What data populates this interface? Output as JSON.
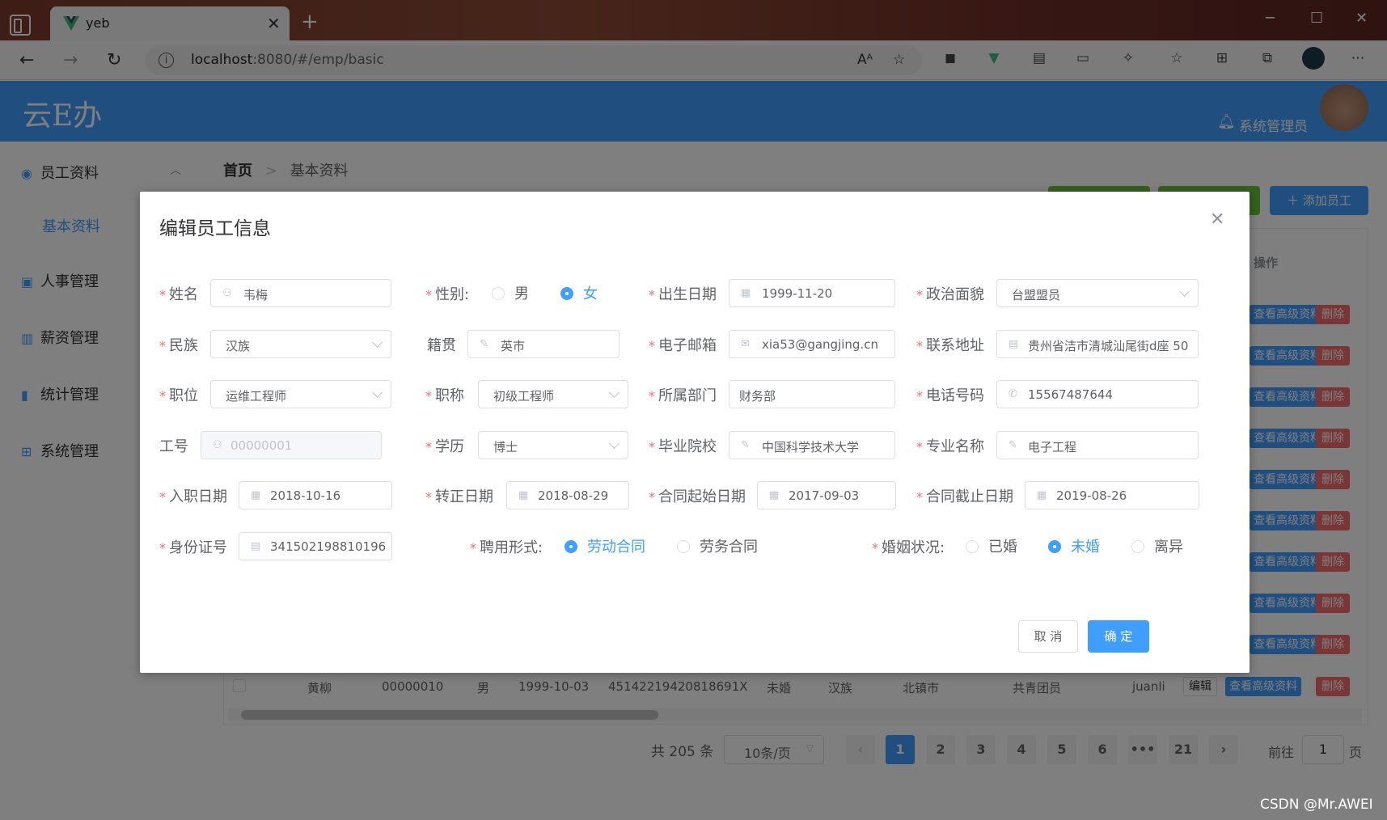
{
  "browser": {
    "tab_title": "yeb",
    "url_host": "localhost",
    "url_rest": ":8080/#/emp/basic"
  },
  "header": {
    "logo": "云E办",
    "user": "系统管理员"
  },
  "sidebar": {
    "items": [
      {
        "label": "员工资料"
      },
      {
        "label": "人事管理"
      },
      {
        "label": "薪资管理"
      },
      {
        "label": "统计管理"
      },
      {
        "label": "系统管理"
      }
    ],
    "active_sub": "基本资料"
  },
  "breadcrumb": {
    "home": "首页",
    "sep": ">",
    "current": "基本资料"
  },
  "toolbar": {
    "add_label": "添加员工"
  },
  "table": {
    "op_header": "操作",
    "adv_label": "查看高级资料",
    "del_label": "删除",
    "edit_label": "编辑",
    "last_row": {
      "name": "黄柳",
      "id": "00000010",
      "gender": "男",
      "birthday": "1999-10-03",
      "idcard": "45142219420818691X",
      "wedlock": "未婚",
      "nation": "汉族",
      "native": "北镇市",
      "politic": "共青团员",
      "email": "juanli"
    }
  },
  "pager": {
    "total": "共 205 条",
    "size": "10条/页",
    "pages": [
      "1",
      "2",
      "3",
      "4",
      "5",
      "6",
      "•••",
      "21"
    ],
    "goto_prefix": "前往",
    "goto_value": "1",
    "goto_suffix": "页"
  },
  "watermark": "CSDN @Mr.AWEI",
  "dialog": {
    "title": "编辑员工信息",
    "fields": {
      "name": {
        "label": "姓名",
        "value": "韦梅"
      },
      "gender": {
        "label": "性别:",
        "options": [
          "男",
          "女"
        ],
        "selected": "女"
      },
      "birthday": {
        "label": "出生日期",
        "value": "1999-11-20"
      },
      "politic": {
        "label": "政治面貌",
        "value": "台盟盟员"
      },
      "nation": {
        "label": "民族",
        "value": "汉族"
      },
      "native_place": {
        "label": "籍贯",
        "value": "英市"
      },
      "email": {
        "label": "电子邮箱",
        "value": "xia53@gangjing.cn"
      },
      "address": {
        "label": "联系地址",
        "value": "贵州省洁市清城汕尾街d座 50"
      },
      "job_level": {
        "label": "职位",
        "value": "运维工程师"
      },
      "title": {
        "label": "职称",
        "value": "初级工程师"
      },
      "department": {
        "label": "所属部门",
        "value": "财务部"
      },
      "phone": {
        "label": "电话号码",
        "value": "15567487644"
      },
      "work_id": {
        "label": "工号",
        "value": "00000001"
      },
      "degree": {
        "label": "学历",
        "value": "博士"
      },
      "school": {
        "label": "毕业院校",
        "value": "中国科学技术大学"
      },
      "specialty": {
        "label": "专业名称",
        "value": "电子工程"
      },
      "begin_date": {
        "label": "入职日期",
        "value": "2018-10-16"
      },
      "conversion": {
        "label": "转正日期",
        "value": "2018-08-29"
      },
      "contract_begin": {
        "label": "合同起始日期",
        "value": "2017-09-03"
      },
      "contract_end": {
        "label": "合同截止日期",
        "value": "2019-08-26"
      },
      "idcard": {
        "label": "身份证号",
        "value": "341502198810196"
      },
      "engage_form": {
        "label": "聘用形式:",
        "options": [
          "劳动合同",
          "劳务合同"
        ],
        "selected": "劳动合同"
      },
      "wedlock": {
        "label": "婚姻状况:",
        "options": [
          "已婚",
          "未婚",
          "离异"
        ],
        "selected": "未婚"
      }
    },
    "cancel_label": "取 消",
    "ok_label": "确 定"
  },
  "colors": {
    "primary": "#409eff",
    "danger": "#f56c6c",
    "success": "#67c23a"
  }
}
